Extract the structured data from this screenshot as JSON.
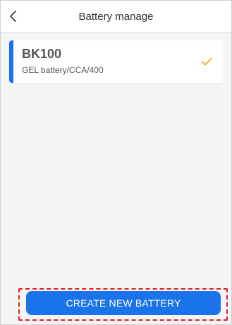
{
  "header": {
    "title": "Battery manage",
    "back_icon": "chevron-left-icon"
  },
  "batteries": [
    {
      "name": "BK100",
      "detail": "GEL battery/CCA/400",
      "selected": true,
      "accent_color": "#1a73e8",
      "check_color": "#f5a623"
    }
  ],
  "footer": {
    "create_label": "CREATE NEW BATTERY",
    "button_color": "#1a73e8",
    "highlight_color": "#e21b1b"
  }
}
